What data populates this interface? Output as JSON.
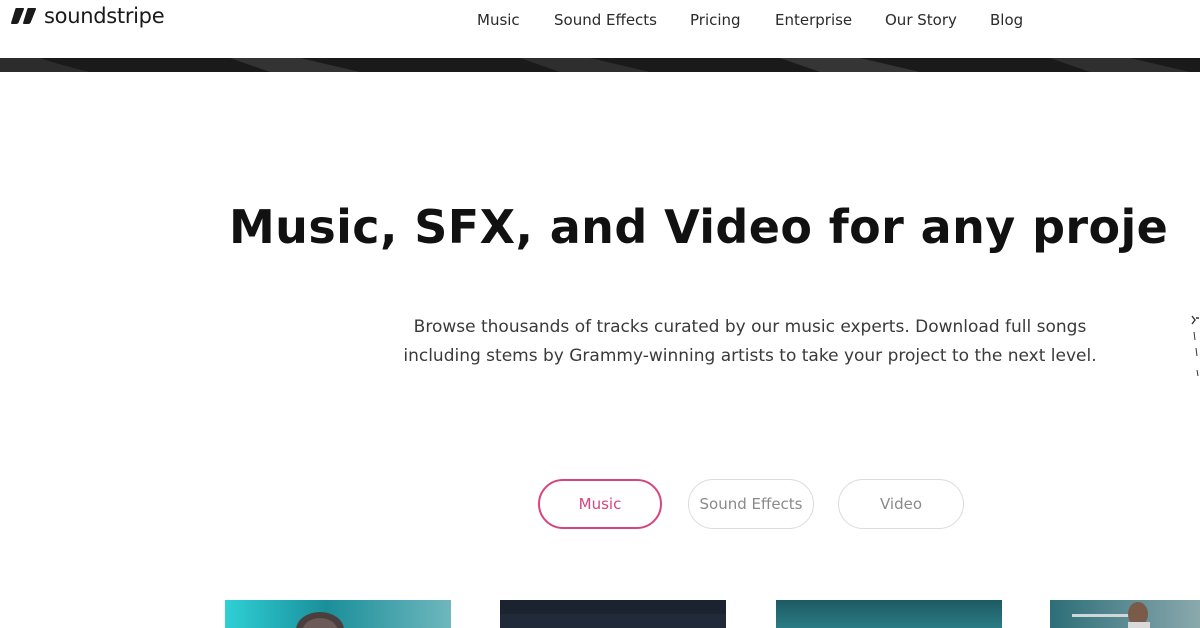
{
  "header": {
    "logo_text": "soundstripe",
    "nav": [
      {
        "label": "Music"
      },
      {
        "label": "Sound Effects"
      },
      {
        "label": "Pricing"
      },
      {
        "label": "Enterprise"
      },
      {
        "label": "Our Story"
      },
      {
        "label": "Blog"
      }
    ]
  },
  "hero": {
    "headline": "Music, SFX, and Video for any proje",
    "subtext": "Browse thousands of tracks curated by our music experts. Download full songs including stems by Grammy-winning artists to take your project to the next level."
  },
  "tabs": [
    {
      "label": "Music",
      "active": true
    },
    {
      "label": "Sound Effects",
      "active": false
    },
    {
      "label": "Video",
      "active": false
    }
  ],
  "colors": {
    "accent": "#d6457f",
    "headline": "#111111",
    "body_text": "#3a3a3a",
    "band_dark": "#1a1a1a"
  },
  "icons": {
    "logo": "soundstripe-logo-icon"
  }
}
